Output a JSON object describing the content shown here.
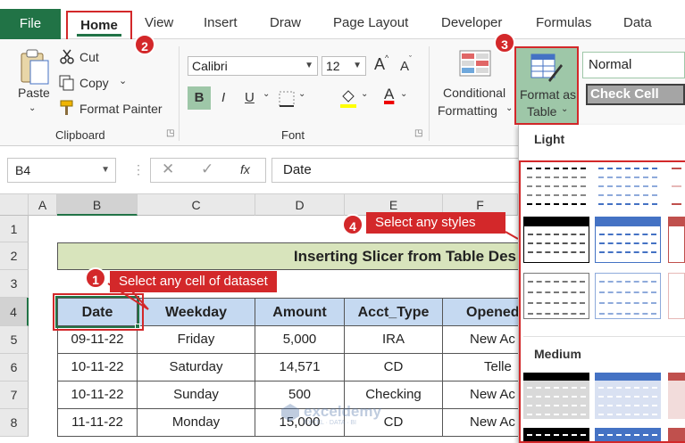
{
  "tabs": [
    "File",
    "Home",
    "View",
    "Insert",
    "Draw",
    "Page Layout",
    "Developer",
    "Formulas",
    "Data"
  ],
  "clipboard": {
    "paste": "Paste",
    "cut": "Cut",
    "copy": "Copy",
    "format_painter": "Format Painter",
    "group": "Clipboard"
  },
  "font": {
    "name": "Calibri",
    "size": "12",
    "bold": "B",
    "italic": "I",
    "underline": "U",
    "grow": "A",
    "shrink": "A",
    "color_letter": "A",
    "group": "Font"
  },
  "styles": {
    "conditional_line1": "Conditional",
    "conditional_line2": "Formatting",
    "format_table_line1": "Format as",
    "format_table_line2": "Table",
    "normal": "Normal",
    "check_cell": "Check Cell"
  },
  "formula_bar": {
    "name_box": "B4",
    "value": "Date",
    "fx": "fx"
  },
  "columns": [
    "A",
    "B",
    "C",
    "D",
    "E",
    "F"
  ],
  "rows": [
    "1",
    "2",
    "3",
    "4",
    "5",
    "6",
    "7",
    "8"
  ],
  "sheet": {
    "title": "Inserting Slicer from Table Des",
    "headers": [
      "Date",
      "Weekday",
      "Amount",
      "Acct_Type",
      "Opened"
    ],
    "data": [
      [
        "09-11-22",
        "Friday",
        "5,000",
        "IRA",
        "New Ac"
      ],
      [
        "10-11-22",
        "Saturday",
        "14,571",
        "CD",
        "Telle"
      ],
      [
        "10-11-22",
        "Sunday",
        "500",
        "Checking",
        "New Ac"
      ],
      [
        "11-11-22",
        "Monday",
        "15,000",
        "CD",
        "New Ac"
      ]
    ]
  },
  "gallery": {
    "light": "Light",
    "medium": "Medium"
  },
  "annotations": {
    "b1": "1",
    "b2": "2",
    "b3": "3",
    "b4": "4",
    "step1": "Select any cell of dataset",
    "step4": "Select any styles"
  },
  "watermark": {
    "name": "exceldemy",
    "tagline": "EXCEL · DATA · BI"
  },
  "colors": {
    "excel_green": "#217346",
    "annotation_red": "#d3282a",
    "header_blue": "#c5d9f1",
    "title_green": "#d8e4bc"
  }
}
